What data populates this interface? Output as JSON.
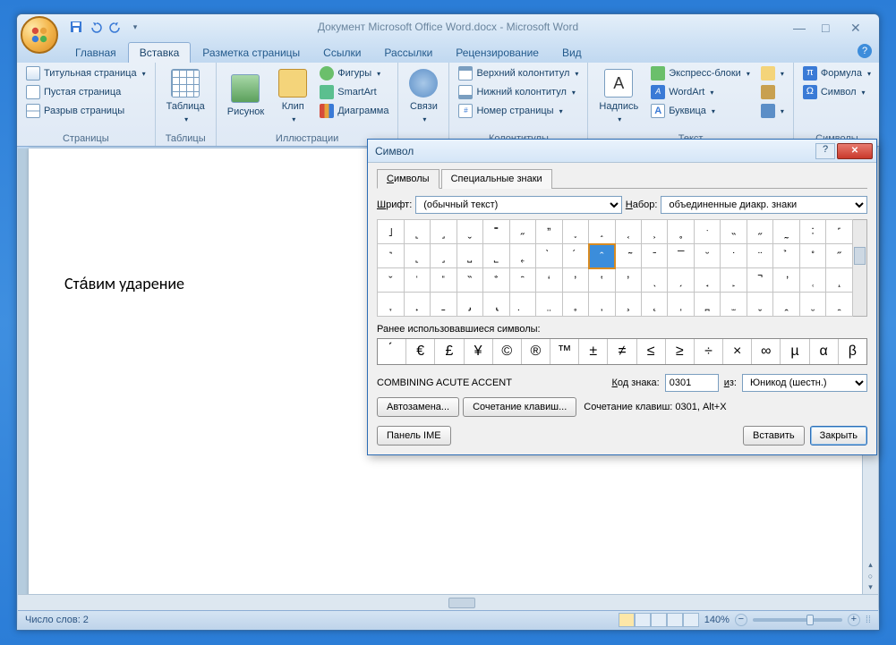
{
  "window": {
    "title": "Документ Microsoft Office Word.docx - Microsoft Word"
  },
  "tabs": {
    "home": "Главная",
    "insert": "Вставка",
    "pagelayout": "Разметка страницы",
    "references": "Ссылки",
    "mailings": "Рассылки",
    "review": "Рецензирование",
    "view": "Вид"
  },
  "ribbon": {
    "pages": {
      "label": "Страницы",
      "cover": "Титульная страница",
      "blank": "Пустая страница",
      "break": "Разрыв страницы"
    },
    "tables": {
      "label": "Таблицы",
      "table": "Таблица"
    },
    "illustrations": {
      "label": "Иллюстрации",
      "picture": "Рисунок",
      "clip": "Клип",
      "shapes": "Фигуры",
      "smartart": "SmartArt",
      "chart": "Диаграмма"
    },
    "links": {
      "label": "Связи",
      "links_btn": "Связи"
    },
    "headerfooter": {
      "label": "Колонтитулы",
      "header": "Верхний колонтитул",
      "footer": "Нижний колонтитул",
      "pagenum": "Номер страницы"
    },
    "text": {
      "label": "Текст",
      "textbox": "Надпись",
      "quickparts": "Экспресс-блоки",
      "wordart": "WordArt",
      "dropcap": "Буквица"
    },
    "symbols": {
      "label": "Символы",
      "equation": "Формула",
      "symbol": "Символ"
    }
  },
  "document": {
    "text": "Ста́вим ударение"
  },
  "statusbar": {
    "wordcount": "Число слов: 2",
    "zoom": "140%"
  },
  "dialog": {
    "title": "Символ",
    "tab_symbols": "Символы",
    "tab_special": "Специальные знаки",
    "font_label": "Шрифт:",
    "font_value": "(обычный текст)",
    "subset_label": "Набор:",
    "subset_value": "объединенные диакр. знаки",
    "recent_label": "Ранее использовавшиеся символы:",
    "recent": [
      "́",
      "€",
      "£",
      "¥",
      "©",
      "®",
      "™",
      "±",
      "≠",
      "≤",
      "≥",
      "÷",
      "×",
      "∞",
      "µ",
      "α",
      "β"
    ],
    "char_name": "COMBINING ACUTE ACCENT",
    "code_label": "Код знака:",
    "code_value": "0301",
    "from_label": "из:",
    "from_value": "Юникод (шестн.)",
    "autocorrect": "Автозамена...",
    "shortcut_btn": "Сочетание клавиш...",
    "shortcut_text": "Сочетание клавиш: 0301, Alt+X",
    "ime_panel": "Панель IME",
    "insert": "Вставить",
    "close": "Закрыть",
    "grid": [
      [
        "˩",
        "˻",
        "˼",
        "ˬ",
        "˭",
        "˶",
        "ˮ",
        "˯",
        "˰",
        "˱",
        "˲",
        "˳",
        "ˑ",
        "˵",
        "˶",
        "˷",
        "˸",
        "˹"
      ],
      [
        "˺",
        "˻",
        "˼",
        "˽",
        "˾",
        "˿",
        "̀",
        "́",
        "̂",
        "̃",
        "̄",
        "̅",
        "̆",
        "̇",
        "̈",
        "̉",
        "̊",
        "̋"
      ],
      [
        "̌",
        "̍",
        "̎",
        "̏",
        "̐",
        "̑",
        "̒",
        "̓",
        "̔",
        "̕",
        "̖",
        "̗",
        "̘",
        "̙",
        "̚",
        "̛",
        "̜",
        "̝"
      ],
      [
        "̞",
        "̟",
        "̠",
        "̡",
        "̢",
        "̣",
        "̤",
        "̥",
        "̦",
        "̧",
        "̨",
        "̩",
        "̪",
        "̫",
        "̬",
        "̭",
        "̮",
        "̯"
      ]
    ],
    "selected_row": 1,
    "selected_col": 8
  }
}
